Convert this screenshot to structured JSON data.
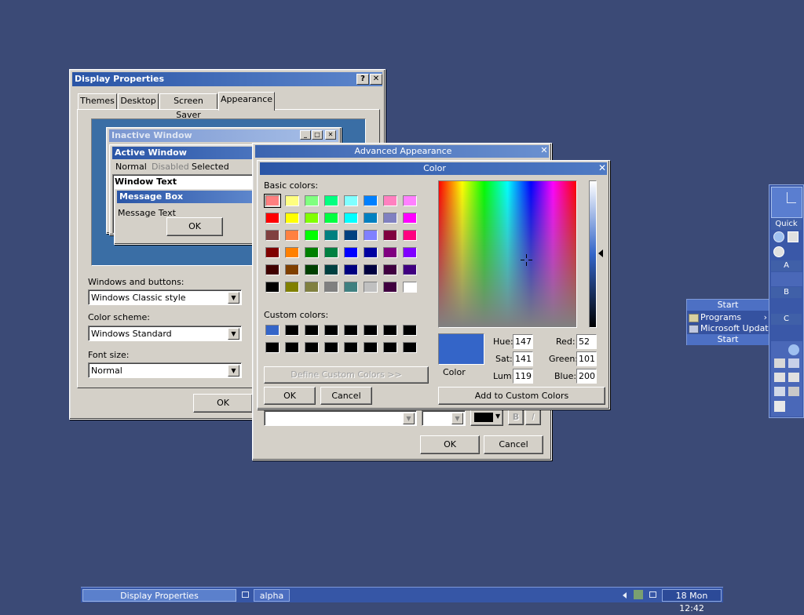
{
  "display_properties": {
    "title": "Display Properties",
    "help_btn": "?",
    "close_btn": "✕",
    "tabs": [
      "Themes",
      "Desktop",
      "Screen Saver",
      "Appearance"
    ],
    "preview": {
      "inactive_title": "Inactive Window",
      "active_title": "Active Window",
      "menu": [
        "Normal",
        "Disabled",
        "Selected"
      ],
      "window_text": "Window Text",
      "msgbox_title": "Message Box",
      "msgbox_text": "Message Text",
      "msgbox_ok": "OK"
    },
    "windows_buttons_label": "Windows and buttons:",
    "windows_buttons_value": "Windows Classic style",
    "color_scheme_label": "Color scheme:",
    "color_scheme_value": "Windows Standard",
    "font_size_label": "Font size:",
    "font_size_value": "Normal",
    "ok": "OK"
  },
  "advanced_appearance": {
    "title": "Advanced Appearance",
    "close_btn": "✕",
    "bold_btn": "B",
    "italic_btn": "I",
    "ok": "OK",
    "cancel": "Cancel"
  },
  "color_dialog": {
    "title": "Color",
    "close_btn": "✕",
    "basic_label": "Basic colors:",
    "custom_label": "Custom colors:",
    "basic_colors": [
      "#ff8080",
      "#ffff80",
      "#80ff80",
      "#00ff80",
      "#80ffff",
      "#0080ff",
      "#ff80c0",
      "#ff80ff",
      "#ff0000",
      "#ffff00",
      "#80ff00",
      "#00ff40",
      "#00ffff",
      "#0080c0",
      "#8080c0",
      "#ff00ff",
      "#804040",
      "#ff8040",
      "#00ff00",
      "#008080",
      "#004080",
      "#8080ff",
      "#800040",
      "#ff0080",
      "#800000",
      "#ff8000",
      "#008000",
      "#008040",
      "#0000ff",
      "#0000a0",
      "#800080",
      "#8000ff",
      "#400000",
      "#804000",
      "#004000",
      "#004040",
      "#000080",
      "#000040",
      "#400040",
      "#400080",
      "#000000",
      "#808000",
      "#808040",
      "#808080",
      "#408080",
      "#c0c0c0",
      "#400040",
      "#ffffff"
    ],
    "custom_colors": [
      "#3465c8",
      "#000000",
      "#000000",
      "#000000",
      "#000000",
      "#000000",
      "#000000",
      "#000000",
      "#000000",
      "#000000",
      "#000000",
      "#000000",
      "#000000",
      "#000000",
      "#000000",
      "#000000"
    ],
    "define_custom": "Define Custom Colors >>",
    "ok": "OK",
    "cancel": "Cancel",
    "color_label": "Color",
    "selected_color": "#3465c8",
    "hue_label": "Hue:",
    "hue": "147",
    "sat_label": "Sat:",
    "sat": "141",
    "lum_label": "Lum:",
    "lum": "119",
    "red_label": "Red:",
    "red": "52",
    "green_label": "Green:",
    "green": "101",
    "blue_label": "Blue:",
    "blue": "200",
    "add_custom": "Add to Custom Colors"
  },
  "start_menu": {
    "header": "Start",
    "items": [
      "Programs",
      "Microsoft Update"
    ],
    "footer": "Start"
  },
  "dock": {
    "quick_label": "Quick",
    "sections": [
      "A",
      "B",
      "C"
    ]
  },
  "taskbar": {
    "tasks": [
      "Display Properties",
      "alpha"
    ],
    "clock": "18 Mon 12:42"
  },
  "colors": {
    "desktop": "#3b4a76",
    "title_active": "#2b57a8",
    "title_inactive": "#5a7fc0"
  }
}
